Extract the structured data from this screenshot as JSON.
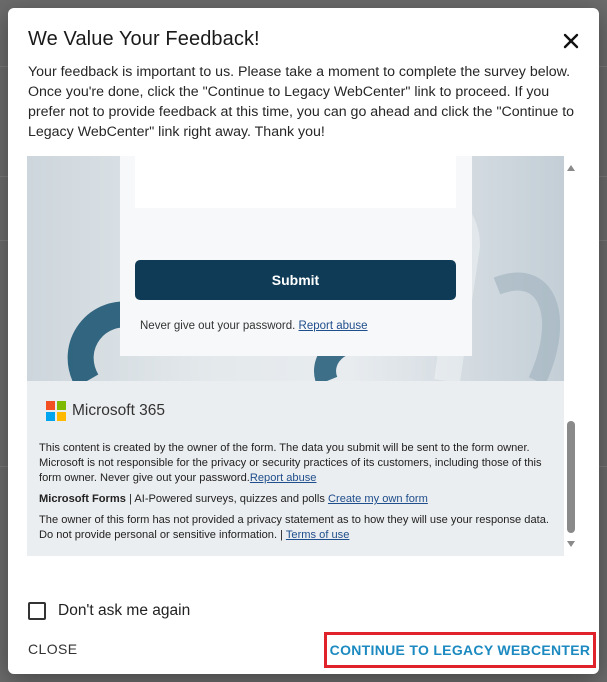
{
  "modal": {
    "title": "We Value Your Feedback!",
    "description": "Your feedback is important to us. Please take a moment to complete the survey below. Once you're done, click the \"Continue to Legacy WebCenter\" link to proceed. If you prefer not to provide feedback at this time, you can go ahead and click the \"Continue to Legacy WebCenter\" link right away. Thank you!",
    "close_icon": "close-icon"
  },
  "form": {
    "submit_label": "Submit",
    "password_note": "Never give out your password.",
    "report_abuse": "Report abuse"
  },
  "ms_footer": {
    "logo_label": "Microsoft 365",
    "logo_colors": [
      "#f25022",
      "#7fba00",
      "#00a4ef",
      "#ffb900"
    ],
    "disclaimer": "This content is created by the owner of the form. The data you submit will be sent to the form owner. Microsoft is not responsible for the privacy or security practices of its customers, including those of this form owner. Never give out your password.",
    "disclaimer_link": "Report abuse",
    "forms_brand": "Microsoft Forms",
    "forms_tagline": " | AI-Powered surveys, quizzes and polls ",
    "create_link": "Create my own form",
    "privacy_text": "The owner of this form has not provided a privacy statement as to how they will use your response data. Do not provide personal or sensitive information. | ",
    "terms_link": "Terms of use"
  },
  "options": {
    "dont_ask_label": "Don't ask me again",
    "dont_ask_checked": false
  },
  "actions": {
    "close_label": "CLOSE",
    "continue_label": "CONTINUE TO LEGACY WEBCENTER"
  },
  "colors": {
    "submit_bg": "#0f3b57",
    "continue_text": "#1c8ac0",
    "highlight_border": "#e0232a",
    "link": "#1f4e8c"
  }
}
